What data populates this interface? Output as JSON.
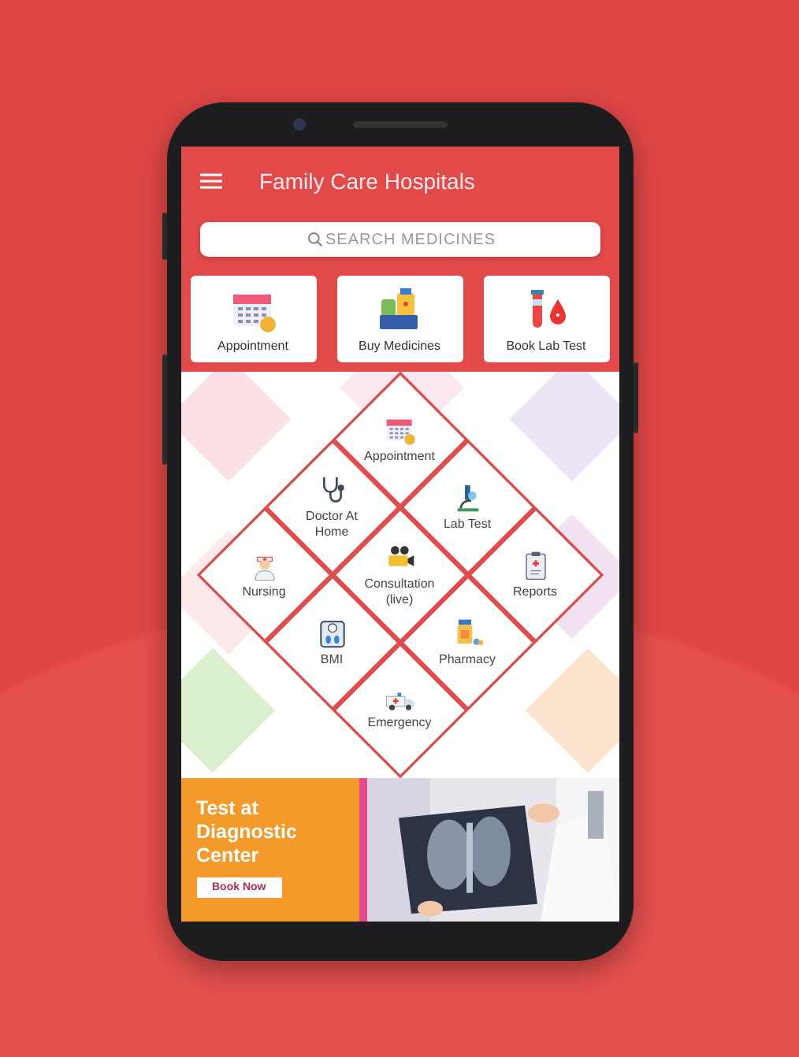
{
  "app_bar": {
    "title": "Family Care Hospitals"
  },
  "search": {
    "placeholder": "SEARCH MEDICINES"
  },
  "quick_actions": [
    {
      "label": "Appointment",
      "kind": "calendar"
    },
    {
      "label": "Buy Medicines",
      "kind": "medicines"
    },
    {
      "label": "Book Lab Test",
      "kind": "labtest"
    }
  ],
  "services": [
    {
      "label": "Appointment",
      "kind": "calendar"
    },
    {
      "label": "Lab Test",
      "kind": "microscope"
    },
    {
      "label": "Reports",
      "kind": "report"
    },
    {
      "label": "Doctor At Home",
      "kind": "stethoscope"
    },
    {
      "label": "Consultation (live)",
      "kind": "camera"
    },
    {
      "label": "Pharmacy",
      "kind": "pharmacy"
    },
    {
      "label": "Nursing",
      "kind": "nurse"
    },
    {
      "label": "BMI",
      "kind": "scale"
    },
    {
      "label": "Emergency",
      "kind": "ambulance"
    }
  ],
  "banner": {
    "title": "Test at Diagnostic Center",
    "button": "Book Now"
  }
}
